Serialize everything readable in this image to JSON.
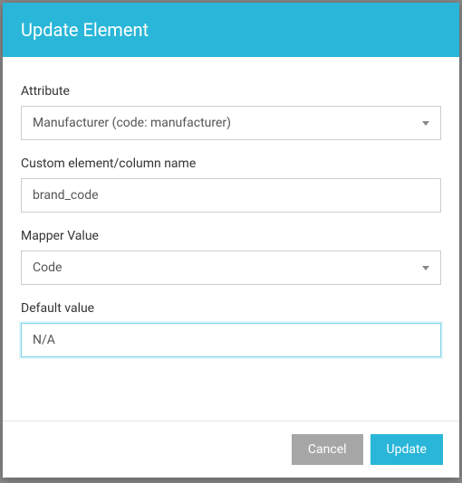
{
  "header": {
    "title": "Update Element"
  },
  "form": {
    "attribute": {
      "label": "Attribute",
      "value": "Manufacturer (code: manufacturer)"
    },
    "custom_name": {
      "label": "Custom element/column name",
      "value": "brand_code"
    },
    "mapper_value": {
      "label": "Mapper Value",
      "value": "Code"
    },
    "default_value": {
      "label": "Default value",
      "value": "N/A"
    }
  },
  "footer": {
    "cancel_label": "Cancel",
    "update_label": "Update"
  }
}
